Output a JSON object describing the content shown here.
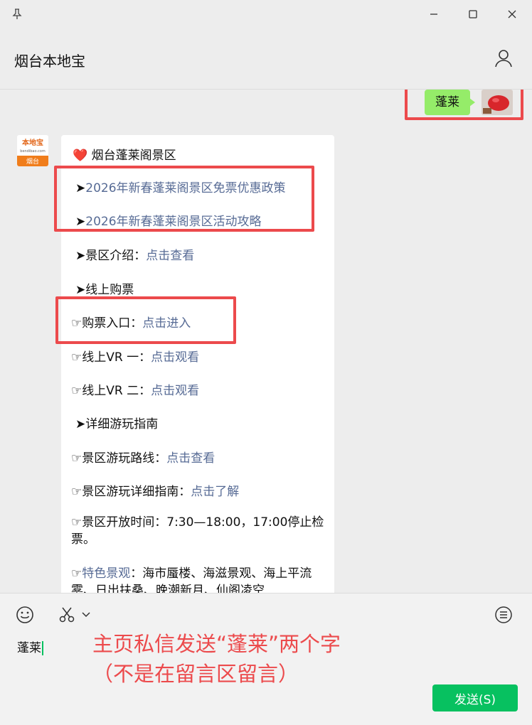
{
  "window": {
    "title": "烟台本地宝"
  },
  "chat": {
    "outgoing_message": "蓬莱",
    "incoming": {
      "heart": "❤️",
      "header": "烟台蓬莱阁景区",
      "items": [
        {
          "prefix": "➤",
          "text": "",
          "link": "2026年新春蓬莱阁景区免票优惠政策"
        },
        {
          "prefix": "➤",
          "text": "",
          "link": "2026年新春蓬莱阁景区活动攻略"
        },
        {
          "prefix": "➤",
          "text": "景区介绍：",
          "link": "点击查看"
        },
        {
          "prefix": "➤",
          "text": "线上购票",
          "link": ""
        },
        {
          "prefix": "☞",
          "text": "购票入口：",
          "link": "点击进入"
        },
        {
          "prefix": "☞",
          "text": "线上VR 一：",
          "link": "点击观看"
        },
        {
          "prefix": "☞",
          "text": "线上VR 二：",
          "link": "点击观看"
        },
        {
          "prefix": "➤",
          "text": "详细游玩指南",
          "link": ""
        },
        {
          "prefix": "☞",
          "text": "景区游玩路线：",
          "link": "点击查看"
        },
        {
          "prefix": "☞",
          "text": "景区游玩详细指南：",
          "link": "点击了解"
        },
        {
          "prefix": "☞",
          "text": "景区开放时间：7:30—18:00，17:00停止检票。",
          "link": ""
        },
        {
          "prefix": "☞",
          "link": "特色景观",
          "text": "：海市蜃楼、海滋景观、海上平流雾、日出扶桑、晚潮新月、仙阁凌空"
        }
      ]
    }
  },
  "input": {
    "draft": "蓬莱",
    "send_label": "发送(S)"
  },
  "annotation": {
    "line1": "主页私信发送“蓬莱”两个字",
    "line2": "（不是在留言区留言）"
  },
  "logo": {
    "top": "本地宝",
    "middle": "bendibao.com",
    "bottom": "烟台"
  },
  "colors": {
    "accent_green": "#07c160",
    "bubble_green": "#95ec69",
    "link_blue": "#576b95",
    "annotation_red": "#ec4a4c"
  }
}
